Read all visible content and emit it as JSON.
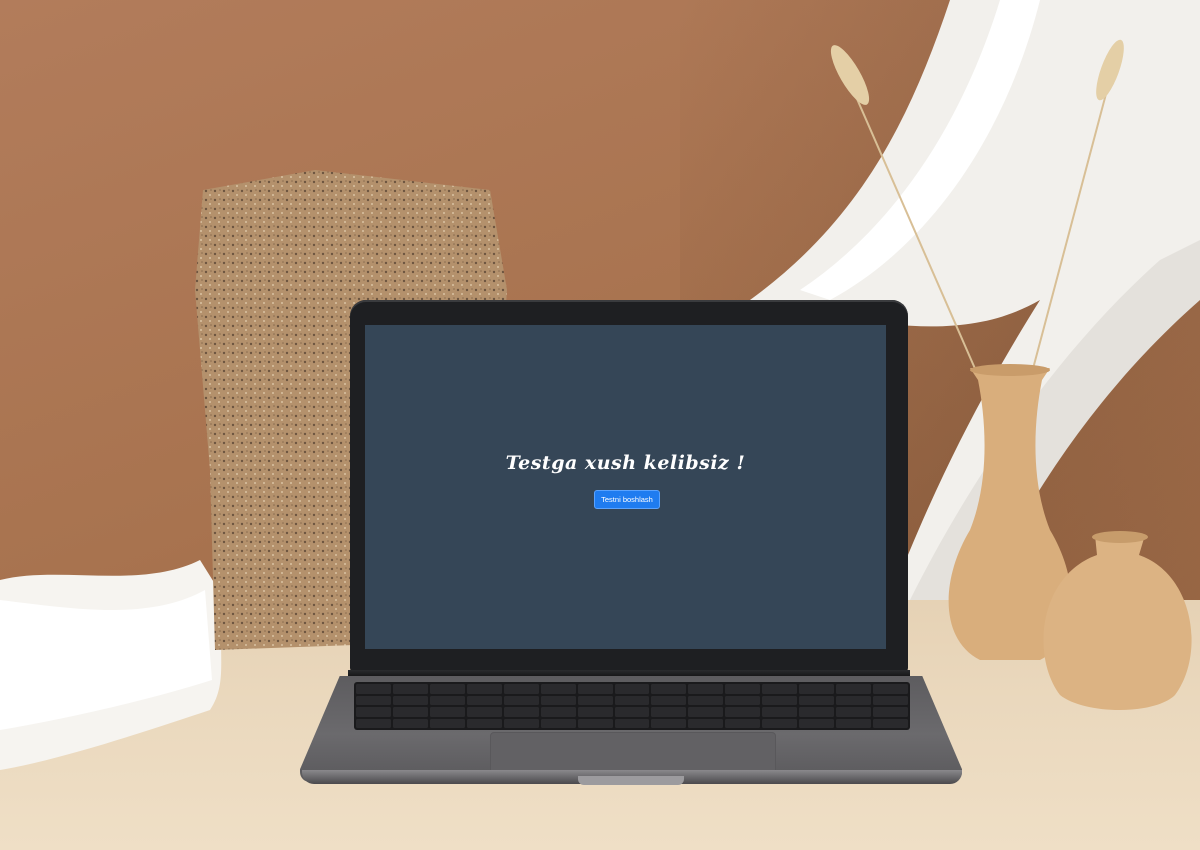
{
  "screen": {
    "title": "Testga xush kelibsiz !",
    "start_button_label": "Testni boshlash"
  },
  "colors": {
    "screen_background": "#354657",
    "button": "#1f7cf0",
    "wall": "#a8734f",
    "table": "#ead8bd"
  },
  "icons": [
    "laptop-icon"
  ]
}
